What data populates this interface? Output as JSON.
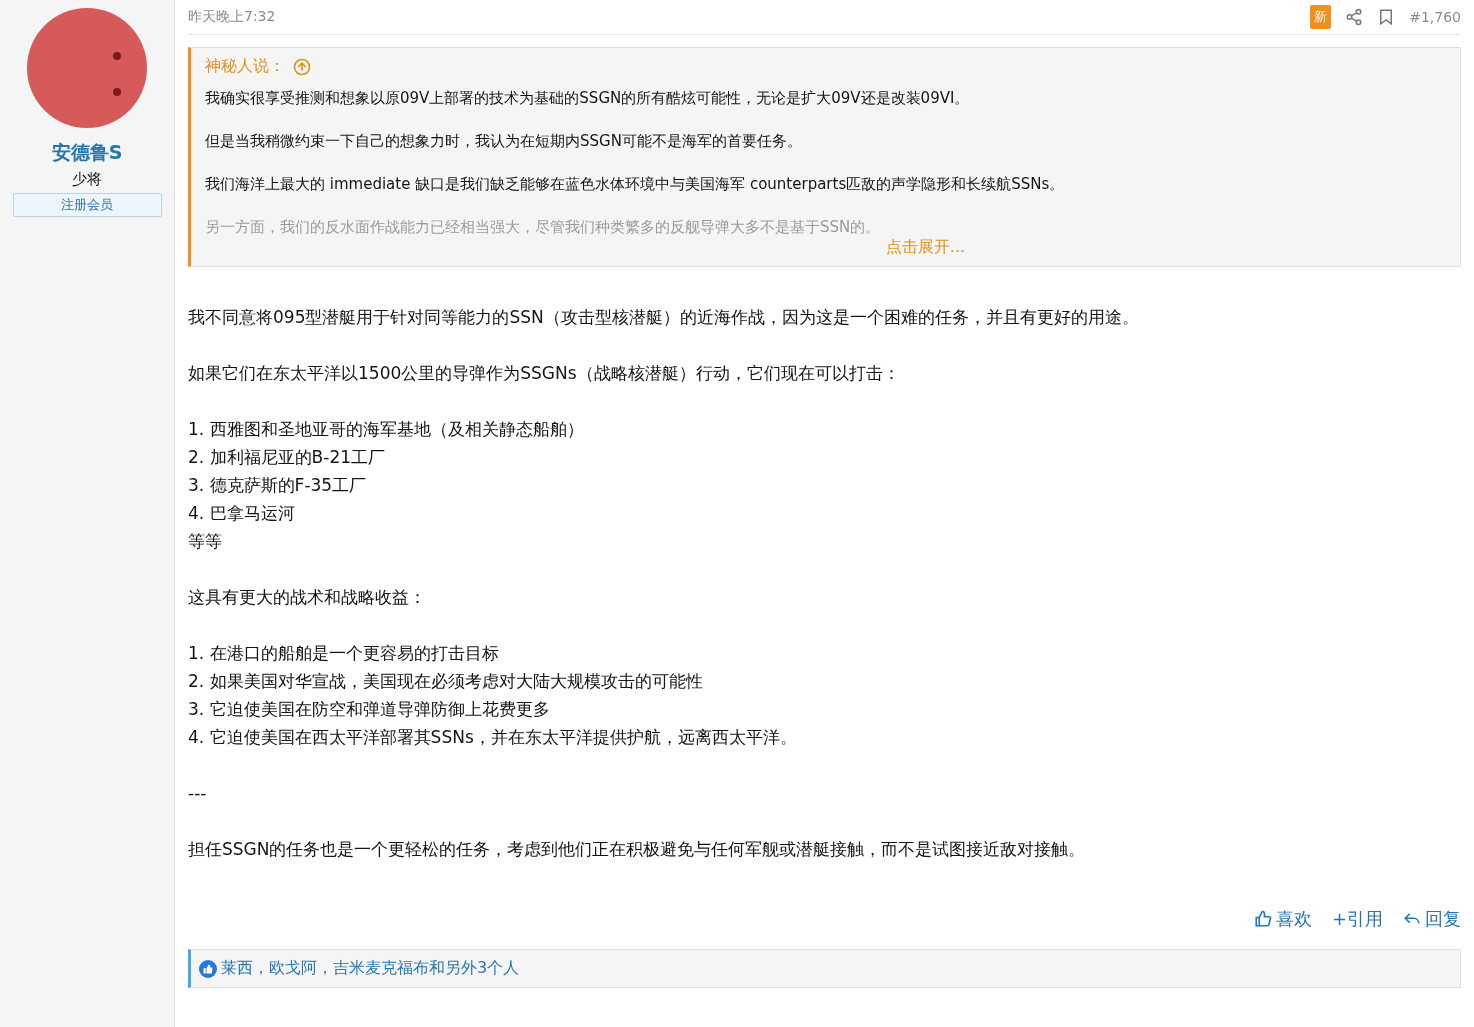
{
  "user": {
    "name": "安德鲁S",
    "rank": "少将",
    "badge": "注册会员"
  },
  "post": {
    "time": "昨天晚上7:32",
    "new_badge": "新",
    "number": "#1,760"
  },
  "quote": {
    "author": "神秘人说：",
    "paragraphs": [
      "我确实很享受推测和想象以原09V上部署的技术为基础的SSGN的所有酷炫可能性，无论是扩大09V还是改装09VI。",
      "但是当我稍微约束一下自己的想象力时，我认为在短期内SSGN可能不是海军的首要任务。",
      "我们海洋上最大的 immediate 缺口是我们缺乏能够在蓝色水体环境中与美国海军 counterparts匹敌的声学隐形和长续航SSNs。"
    ],
    "faded": "另一方面，我们的反水面作战能力已经相当强大，尽管我们种类繁多的反舰导弹大多不是基于SSN的。",
    "expand": "点击展开..."
  },
  "body": [
    [
      "我不同意将095型潜艇用于针对同等能力的SSN（攻击型核潜艇）的近海作战，因为这是一个困难的任务，并且有更好的用途。"
    ],
    [
      "如果它们在东太平洋以1500公里的导弹作为SSGNs（战略核潜艇）行动，它们现在可以打击："
    ],
    [
      "1. 西雅图和圣地亚哥的海军基地（及相关静态船舶）",
      "2. 加利福尼亚的B-21工厂",
      "3. 德克萨斯的F-35工厂",
      "4. 巴拿马运河",
      "等等"
    ],
    [
      "这具有更大的战术和战略收益："
    ],
    [
      "1. 在港口的船舶是一个更容易的打击目标",
      "2. 如果美国对华宣战，美国现在必须考虑对大陆大规模攻击的可能性",
      "3. 它迫使美国在防空和弹道导弹防御上花费更多",
      "4. 它迫使美国在西太平洋部署其SSNs，并在东太平洋提供护航，远离西太平洋。"
    ],
    [
      "---"
    ],
    [
      "担任SSGN的任务也是一个更轻松的任务，考虑到他们正在积极避免与任何军舰或潜艇接触，而不是试图接近敌对接触。"
    ]
  ],
  "actions": [
    {
      "kind": "like",
      "label": "喜欢"
    },
    {
      "kind": "quote",
      "label": "+引用"
    },
    {
      "kind": "reply",
      "label": "回复"
    }
  ],
  "reactions": "莱西，欧戈阿，吉米麦克福布和另外3个人"
}
